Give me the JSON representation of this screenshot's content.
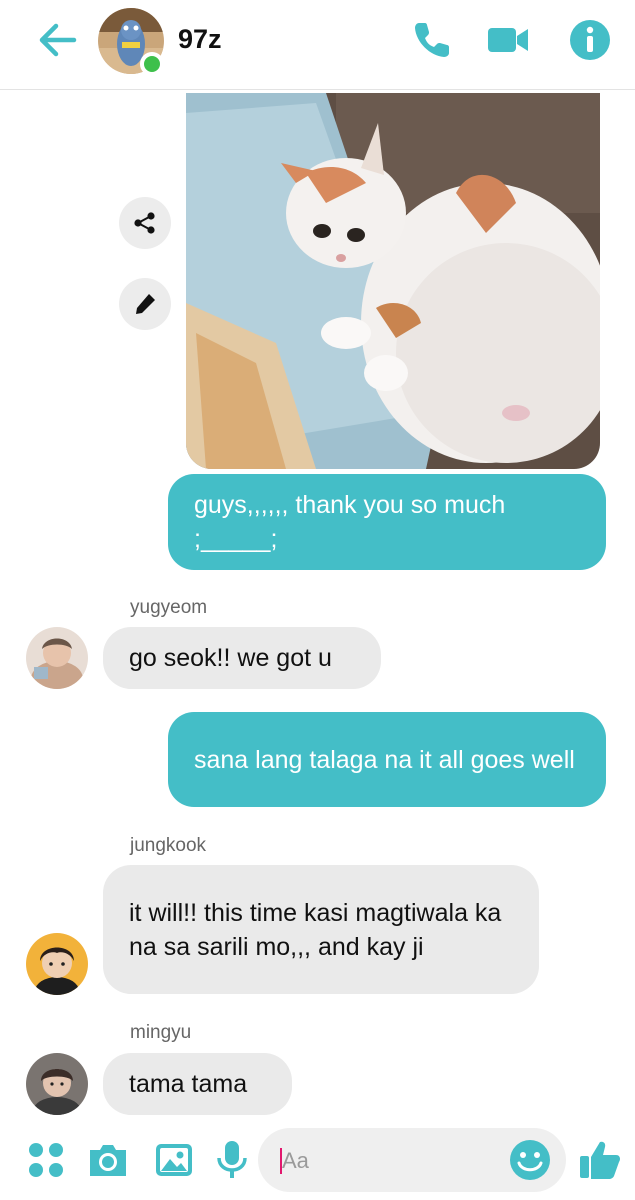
{
  "header": {
    "contact_name": "97z",
    "online": true,
    "icons": [
      "back-arrow-icon",
      "phone-icon",
      "video-camera-icon",
      "info-icon"
    ],
    "accent_color": "#44bec7"
  },
  "messages": [
    {
      "type": "image",
      "direction": "outgoing",
      "description": "crying-cat"
    },
    {
      "type": "text",
      "direction": "outgoing",
      "text": "guys,,,,,, thank you so much ;_____;"
    },
    {
      "type": "text",
      "direction": "incoming",
      "sender": "yugyeom",
      "text": "go seok!! we got u"
    },
    {
      "type": "text",
      "direction": "outgoing",
      "text": "sana lang talaga na it all goes well"
    },
    {
      "type": "text",
      "direction": "incoming",
      "sender": "jungkook",
      "text": "it will!! this time kasi magtiwala ka na sa sarili mo,,, and kay ji"
    },
    {
      "type": "text",
      "direction": "incoming",
      "sender": "mingyu",
      "text": "tama tama"
    }
  ],
  "composer": {
    "placeholder": "Aa",
    "icons": [
      "more-apps-icon",
      "camera-icon",
      "gallery-icon",
      "microphone-icon",
      "emoji-icon",
      "thumbs-up-icon"
    ]
  }
}
